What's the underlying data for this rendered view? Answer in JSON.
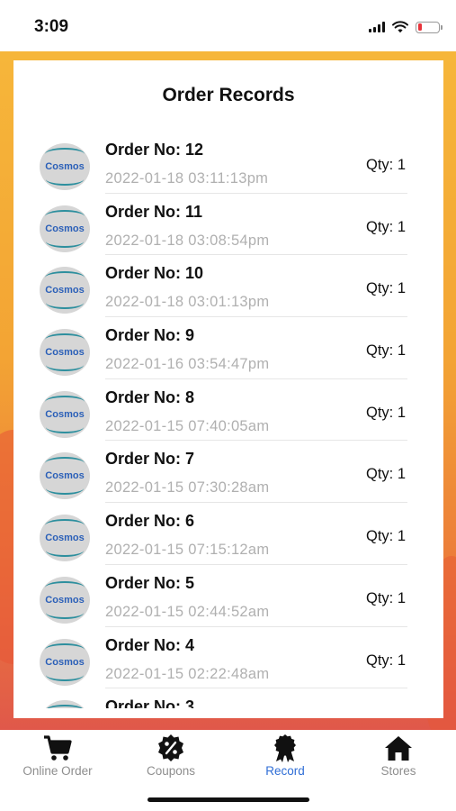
{
  "status_bar": {
    "time": "3:09"
  },
  "header": {
    "title": "Order Records"
  },
  "logo_text": "Cosmos",
  "orders": [
    {
      "order_no": "Order No: 12",
      "datetime": "2022-01-18  03:11:13pm",
      "qty": "Qty: 1"
    },
    {
      "order_no": "Order No: 11",
      "datetime": "2022-01-18  03:08:54pm",
      "qty": "Qty: 1"
    },
    {
      "order_no": "Order No: 10",
      "datetime": "2022-01-18  03:01:13pm",
      "qty": "Qty: 1"
    },
    {
      "order_no": "Order No: 9",
      "datetime": "2022-01-16  03:54:47pm",
      "qty": "Qty: 1"
    },
    {
      "order_no": "Order No: 8",
      "datetime": "2022-01-15  07:40:05am",
      "qty": "Qty: 1"
    },
    {
      "order_no": "Order No: 7",
      "datetime": "2022-01-15  07:30:28am",
      "qty": "Qty: 1"
    },
    {
      "order_no": "Order No: 6",
      "datetime": "2022-01-15  07:15:12am",
      "qty": "Qty: 1"
    },
    {
      "order_no": "Order No: 5",
      "datetime": "2022-01-15  02:44:52am",
      "qty": "Qty: 1"
    },
    {
      "order_no": "Order No: 4",
      "datetime": "2022-01-15  02:22:48am",
      "qty": "Qty: 1"
    },
    {
      "order_no": "Order No: 3",
      "datetime": "",
      "qty": ""
    }
  ],
  "tabs": [
    {
      "label": "Online Order",
      "icon": "cart-icon",
      "active": false
    },
    {
      "label": "Coupons",
      "icon": "coupon-badge-icon",
      "active": false
    },
    {
      "label": "Record",
      "icon": "award-ribbon-icon",
      "active": true
    },
    {
      "label": "Stores",
      "icon": "home-icon",
      "active": false
    }
  ],
  "colors": {
    "active_tab": "#2f6ed6",
    "inactive_tab": "#8e8e8e",
    "background_top": "#f6b63a",
    "background_bottom": "#e0584a"
  }
}
